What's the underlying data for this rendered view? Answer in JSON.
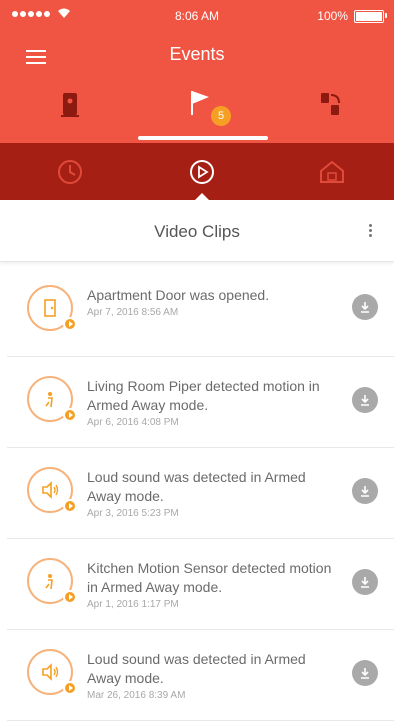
{
  "status_bar": {
    "time": "8:06 AM",
    "battery": "100%"
  },
  "header": {
    "title": "Events",
    "badge_count": "5"
  },
  "main_tabs": [
    {
      "icon": "device-icon"
    },
    {
      "icon": "flag-icon",
      "selected": true
    },
    {
      "icon": "sensor-icon"
    }
  ],
  "sub_tabs": [
    {
      "icon": "history-icon"
    },
    {
      "icon": "play-circle-icon",
      "selected": true
    },
    {
      "icon": "home-icon"
    }
  ],
  "section": {
    "title": "Video Clips"
  },
  "colors": {
    "header": "#f05442",
    "subnav": "#a61f14",
    "accent": "#f5a024"
  },
  "events": [
    {
      "title": "Apartment Door was opened.",
      "time": "Apr 7, 2016 8:56 AM",
      "icon": "door-icon"
    },
    {
      "title": "Living Room Piper detected motion in Armed Away mode.",
      "time": "Apr 6, 2016 4:08 PM",
      "icon": "motion-icon"
    },
    {
      "title": "Loud sound was detected in Armed Away mode.",
      "time": "Apr 3, 2016 5:23 PM",
      "icon": "sound-icon"
    },
    {
      "title": "Kitchen Motion Sensor detected motion in Armed Away mode.",
      "time": "Apr 1, 2016 1:17 PM",
      "icon": "motion-icon"
    },
    {
      "title": "Loud sound was detected in Armed Away mode.",
      "time": "Mar 26, 2016 8:39 AM",
      "icon": "sound-icon"
    }
  ]
}
